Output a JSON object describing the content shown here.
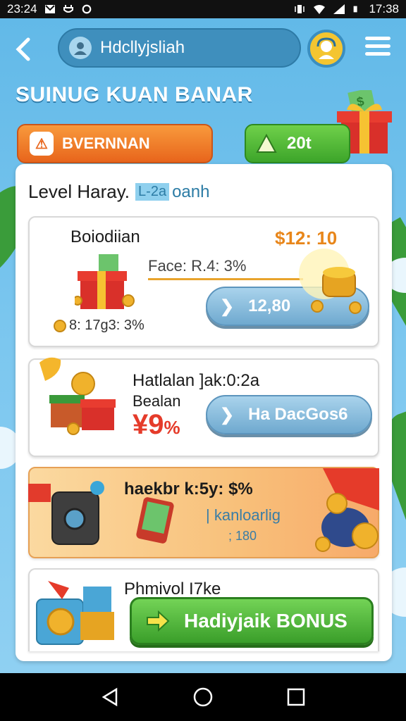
{
  "status_bar": {
    "time": "23:24",
    "clock": "17:38"
  },
  "header": {
    "search_text": "Hdcllyjsliah",
    "page_title": "SUINUG KUAN BANAR",
    "orange_button_label": "BVERNNAN",
    "green_button_label": "20t"
  },
  "panel": {
    "heading": "Level Haray.",
    "heading_tag": "L-2a",
    "heading_tag_text": "oanh",
    "cards": [
      {
        "title": "Boiodiian",
        "price": "$12: 10",
        "face": "Face: R.4: 3%",
        "button_label": "12,80",
        "note": "8: 17g3: 3%"
      },
      {
        "title": "Hatlalan ]ak:0:2a",
        "subtitle": "Bealan",
        "discount": "¥9",
        "discount_unit": "%",
        "button_label": "Ha DacGos6"
      },
      {
        "title": "haekbr k:5y: $%",
        "subtitle": "| kanloarlig",
        "note": "; 180"
      },
      {
        "title": "Phmivol I7ke",
        "button_label": "Hadiyjaik BONUS"
      }
    ]
  },
  "colors": {
    "sky": "#5fb6e6",
    "orange": "#e8651c",
    "green": "#3da52a",
    "price": "#e8861a",
    "red": "#e53b2a"
  },
  "icons": [
    "back-icon",
    "user-icon",
    "support-avatar-icon",
    "menu-icon",
    "alert-icon",
    "triangle-icon",
    "chevron-right-icon",
    "arrow-right-icon"
  ]
}
